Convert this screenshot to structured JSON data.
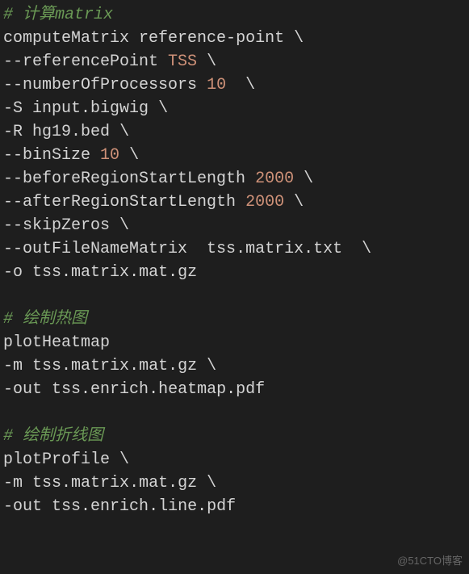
{
  "lines": [
    {
      "tokens": [
        {
          "cls": "comment",
          "t": "# 计算matrix"
        }
      ]
    },
    {
      "tokens": [
        {
          "cls": "text",
          "t": "computeMatrix reference"
        },
        {
          "cls": "punct",
          "t": "-"
        },
        {
          "cls": "text",
          "t": "point "
        },
        {
          "cls": "punct",
          "t": "\\"
        }
      ]
    },
    {
      "tokens": [
        {
          "cls": "punct",
          "t": "--"
        },
        {
          "cls": "text",
          "t": "referencePoint "
        },
        {
          "cls": "keyword",
          "t": "TSS"
        },
        {
          "cls": "text",
          "t": " "
        },
        {
          "cls": "punct",
          "t": "\\"
        }
      ]
    },
    {
      "tokens": [
        {
          "cls": "punct",
          "t": "--"
        },
        {
          "cls": "text",
          "t": "numberOfProcessors "
        },
        {
          "cls": "number",
          "t": "10"
        },
        {
          "cls": "text",
          "t": "  "
        },
        {
          "cls": "punct",
          "t": "\\"
        }
      ]
    },
    {
      "tokens": [
        {
          "cls": "punct",
          "t": "-"
        },
        {
          "cls": "text",
          "t": "S input"
        },
        {
          "cls": "punct",
          "t": "."
        },
        {
          "cls": "text",
          "t": "bigwig "
        },
        {
          "cls": "punct",
          "t": "\\"
        }
      ]
    },
    {
      "tokens": [
        {
          "cls": "punct",
          "t": "-"
        },
        {
          "cls": "text",
          "t": "R hg19"
        },
        {
          "cls": "punct",
          "t": "."
        },
        {
          "cls": "text",
          "t": "bed "
        },
        {
          "cls": "punct",
          "t": "\\"
        }
      ]
    },
    {
      "tokens": [
        {
          "cls": "punct",
          "t": "--"
        },
        {
          "cls": "text",
          "t": "binSize "
        },
        {
          "cls": "number",
          "t": "10"
        },
        {
          "cls": "text",
          "t": " "
        },
        {
          "cls": "punct",
          "t": "\\"
        }
      ]
    },
    {
      "tokens": [
        {
          "cls": "punct",
          "t": "--"
        },
        {
          "cls": "text",
          "t": "beforeRegionStartLength "
        },
        {
          "cls": "number",
          "t": "2000"
        },
        {
          "cls": "text",
          "t": " "
        },
        {
          "cls": "punct",
          "t": "\\"
        }
      ]
    },
    {
      "tokens": [
        {
          "cls": "punct",
          "t": "--"
        },
        {
          "cls": "text",
          "t": "afterRegionStartLength "
        },
        {
          "cls": "number",
          "t": "2000"
        },
        {
          "cls": "text",
          "t": " "
        },
        {
          "cls": "punct",
          "t": "\\"
        }
      ]
    },
    {
      "tokens": [
        {
          "cls": "punct",
          "t": "--"
        },
        {
          "cls": "text",
          "t": "skipZeros "
        },
        {
          "cls": "punct",
          "t": "\\"
        }
      ]
    },
    {
      "tokens": [
        {
          "cls": "punct",
          "t": "--"
        },
        {
          "cls": "text",
          "t": "outFileNameMatrix  tss"
        },
        {
          "cls": "punct",
          "t": "."
        },
        {
          "cls": "text",
          "t": "matrix"
        },
        {
          "cls": "punct",
          "t": "."
        },
        {
          "cls": "text",
          "t": "txt  "
        },
        {
          "cls": "punct",
          "t": "\\"
        }
      ]
    },
    {
      "tokens": [
        {
          "cls": "punct",
          "t": "-"
        },
        {
          "cls": "text",
          "t": "o tss"
        },
        {
          "cls": "punct",
          "t": "."
        },
        {
          "cls": "text",
          "t": "matrix"
        },
        {
          "cls": "punct",
          "t": "."
        },
        {
          "cls": "text",
          "t": "mat"
        },
        {
          "cls": "punct",
          "t": "."
        },
        {
          "cls": "text",
          "t": "gz"
        }
      ]
    },
    {
      "tokens": [
        {
          "cls": "text",
          "t": ""
        }
      ]
    },
    {
      "tokens": [
        {
          "cls": "comment",
          "t": "# 绘制热图"
        }
      ]
    },
    {
      "tokens": [
        {
          "cls": "text",
          "t": "plotHeatmap"
        }
      ]
    },
    {
      "tokens": [
        {
          "cls": "punct",
          "t": "-"
        },
        {
          "cls": "text",
          "t": "m tss"
        },
        {
          "cls": "punct",
          "t": "."
        },
        {
          "cls": "text",
          "t": "matrix"
        },
        {
          "cls": "punct",
          "t": "."
        },
        {
          "cls": "text",
          "t": "mat"
        },
        {
          "cls": "punct",
          "t": "."
        },
        {
          "cls": "text",
          "t": "gz "
        },
        {
          "cls": "punct",
          "t": "\\"
        }
      ]
    },
    {
      "tokens": [
        {
          "cls": "punct",
          "t": "-"
        },
        {
          "cls": "text",
          "t": "out tss"
        },
        {
          "cls": "punct",
          "t": "."
        },
        {
          "cls": "text",
          "t": "enrich"
        },
        {
          "cls": "punct",
          "t": "."
        },
        {
          "cls": "text",
          "t": "heatmap"
        },
        {
          "cls": "punct",
          "t": "."
        },
        {
          "cls": "text",
          "t": "pdf"
        }
      ]
    },
    {
      "tokens": [
        {
          "cls": "text",
          "t": ""
        }
      ]
    },
    {
      "tokens": [
        {
          "cls": "comment",
          "t": "# 绘制折线图"
        }
      ]
    },
    {
      "tokens": [
        {
          "cls": "text",
          "t": "plotProfile "
        },
        {
          "cls": "punct",
          "t": "\\"
        }
      ]
    },
    {
      "tokens": [
        {
          "cls": "punct",
          "t": "-"
        },
        {
          "cls": "text",
          "t": "m tss"
        },
        {
          "cls": "punct",
          "t": "."
        },
        {
          "cls": "text",
          "t": "matrix"
        },
        {
          "cls": "punct",
          "t": "."
        },
        {
          "cls": "text",
          "t": "mat"
        },
        {
          "cls": "punct",
          "t": "."
        },
        {
          "cls": "text",
          "t": "gz "
        },
        {
          "cls": "punct",
          "t": "\\"
        }
      ]
    },
    {
      "tokens": [
        {
          "cls": "punct",
          "t": "-"
        },
        {
          "cls": "text",
          "t": "out tss"
        },
        {
          "cls": "punct",
          "t": "."
        },
        {
          "cls": "text",
          "t": "enrich"
        },
        {
          "cls": "punct",
          "t": "."
        },
        {
          "cls": "text",
          "t": "line"
        },
        {
          "cls": "punct",
          "t": "."
        },
        {
          "cls": "text",
          "t": "pdf"
        }
      ]
    }
  ],
  "watermark": "@51CTO博客"
}
